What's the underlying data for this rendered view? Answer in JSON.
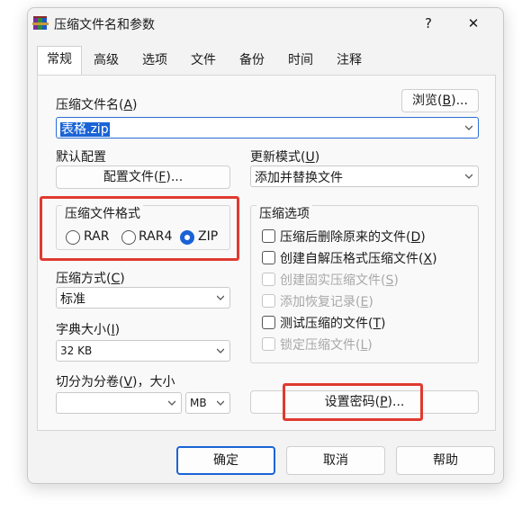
{
  "window": {
    "title": "压缩文件名和参数",
    "help": "?",
    "close": "✕",
    "icon": "winrar-books-icon"
  },
  "tabs": [
    {
      "label": "常规",
      "active": true
    },
    {
      "label": "高级"
    },
    {
      "label": "选项"
    },
    {
      "label": "文件"
    },
    {
      "label": "备份"
    },
    {
      "label": "时间"
    },
    {
      "label": "注释"
    }
  ],
  "archive_name": {
    "label_pre": "压缩文件名(",
    "label_key": "A",
    "label_post": ")",
    "value": "表格.zip",
    "browse_pre": "浏览(",
    "browse_key": "B",
    "browse_post": ")..."
  },
  "default_profile": {
    "label": "默认配置",
    "button_pre": "配置文件(",
    "button_key": "F",
    "button_post": ")..."
  },
  "update_mode": {
    "label_pre": "更新模式(",
    "label_key": "U",
    "label_post": ")",
    "value": "添加并替换文件"
  },
  "archive_format": {
    "title": "压缩文件格式",
    "options": [
      {
        "label": "RAR",
        "key": "R",
        "selected": false
      },
      {
        "label": "RAR4",
        "key": "4",
        "selected": false
      },
      {
        "label": "ZIP",
        "key": "Z",
        "selected": true
      }
    ]
  },
  "compression_method": {
    "label_pre": "压缩方式(",
    "label_key": "C",
    "label_post": ")",
    "value": "标准"
  },
  "dictionary_size": {
    "label_pre": "字典大小(",
    "label_key": "I",
    "label_post": ")",
    "value": "32 KB"
  },
  "split_volumes": {
    "label_pre": "切分为分卷(",
    "label_key": "V",
    "label_post": ")，大小",
    "value": "",
    "unit": "MB"
  },
  "archive_options": {
    "title": "压缩选项",
    "items": [
      {
        "label": "压缩后删除原来的文件",
        "key": "D",
        "checked": false,
        "enabled": true
      },
      {
        "label": "创建自解压格式压缩文件",
        "key": "X",
        "checked": false,
        "enabled": true
      },
      {
        "label": "创建固实压缩文件",
        "key": "S",
        "checked": false,
        "enabled": false
      },
      {
        "label": "添加恢复记录",
        "key": "E",
        "checked": false,
        "enabled": false
      },
      {
        "label": "测试压缩的文件",
        "key": "T",
        "checked": false,
        "enabled": true
      },
      {
        "label": "锁定压缩文件",
        "key": "L",
        "checked": false,
        "enabled": false
      }
    ]
  },
  "set_password": {
    "pre": "设置密码(",
    "key": "P",
    "post": ")..."
  },
  "footer": {
    "ok": "确定",
    "cancel": "取消",
    "help": "帮助"
  },
  "colors": {
    "highlight": "#e03a2f",
    "accent": "#1a63d6"
  }
}
